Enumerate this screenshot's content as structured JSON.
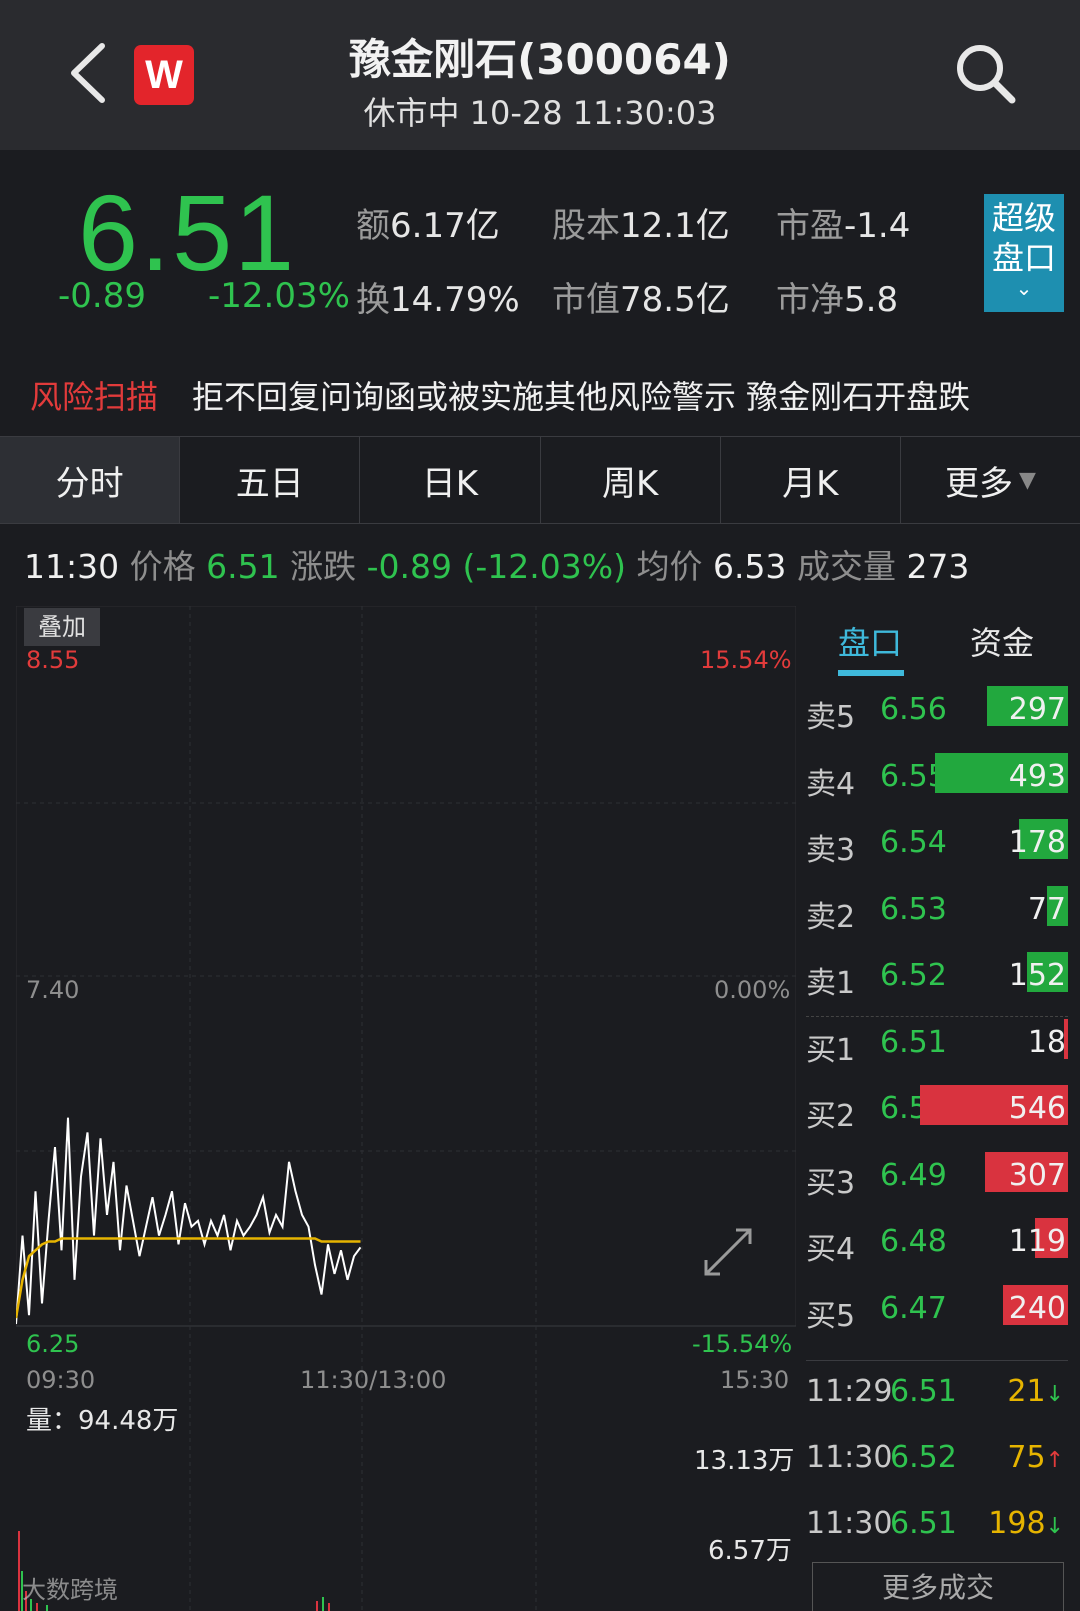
{
  "header": {
    "title": "豫金刚石(300064)",
    "subtitle": "休市中 10-28 11:30:03",
    "logo_letter": "W"
  },
  "quote": {
    "price": "6.51",
    "change": "-0.89",
    "change_pct": "-12.03%",
    "stats": [
      {
        "label": "额",
        "value": "6.17亿"
      },
      {
        "label": "股本",
        "value": "12.1亿"
      },
      {
        "label": "市盈",
        "value": "-1.4"
      },
      {
        "label": "换",
        "value": "14.79%"
      },
      {
        "label": "市值",
        "value": "78.5亿"
      },
      {
        "label": "市净",
        "value": "5.8"
      }
    ],
    "super_label_1": "超级",
    "super_label_2": "盘口"
  },
  "risk": {
    "tag": "风险扫描",
    "text": "拒不回复问询函或被实施其他风险警示 豫金刚石开盘跌"
  },
  "tabs": [
    "分时",
    "五日",
    "日K",
    "周K",
    "月K",
    "更多"
  ],
  "info_line": {
    "time": "11:30",
    "price_label": "价格",
    "price": "6.51",
    "chg_label": "涨跌",
    "chg": "-0.89 (-12.03%)",
    "avg_label": "均价",
    "avg": "6.53",
    "vol_label": "成交量",
    "vol": "273"
  },
  "chart_labels": {
    "overlay_button": "叠加",
    "y_high": "8.55",
    "y_mid": "7.40",
    "y_low": "6.25",
    "pct_high": "15.54%",
    "pct_mid": "0.00%",
    "pct_low": "-15.54%",
    "x_start": "09:30",
    "x_mid": "11:30/13:00",
    "x_end": "15:30",
    "volume_label": "量：94.48万",
    "vol_high": "13.13万",
    "vol_mid": "6.57万"
  },
  "chart_data": {
    "type": "line",
    "ylim": [
      6.25,
      8.55
    ],
    "series": [
      {
        "values": [
          6.25,
          6.55,
          6.28,
          6.7,
          6.32,
          6.6,
          6.85,
          6.5,
          6.95,
          6.4,
          6.75,
          6.9,
          6.55,
          6.88,
          6.62,
          6.8,
          6.5,
          6.72,
          6.6,
          6.48,
          6.58,
          6.68,
          6.55,
          6.62,
          6.7,
          6.52,
          6.66,
          6.58,
          6.6,
          6.52,
          6.6,
          6.55,
          6.62,
          6.5,
          6.6,
          6.55,
          6.58,
          6.62,
          6.68,
          6.56,
          6.62,
          6.58,
          6.8,
          6.7,
          6.62,
          6.58,
          6.45,
          6.35,
          6.52,
          6.42,
          6.5,
          6.4,
          6.48,
          6.51
        ]
      },
      {
        "values": [
          6.27,
          6.4,
          6.48,
          6.5,
          6.52,
          6.53,
          6.53,
          6.54,
          6.54,
          6.54,
          6.54,
          6.54,
          6.54,
          6.54,
          6.54,
          6.54,
          6.54,
          6.54,
          6.54,
          6.54,
          6.54,
          6.54,
          6.54,
          6.54,
          6.54,
          6.54,
          6.54,
          6.54,
          6.54,
          6.54,
          6.54,
          6.54,
          6.54,
          6.54,
          6.54,
          6.54,
          6.54,
          6.54,
          6.54,
          6.54,
          6.54,
          6.54,
          6.54,
          6.54,
          6.54,
          6.54,
          6.54,
          6.53,
          6.53,
          6.53,
          6.53,
          6.53,
          6.53,
          6.53
        ]
      }
    ],
    "x_total_points": 121,
    "xlabels": [
      "09:30",
      "11:30/13:00",
      "15:30"
    ]
  },
  "book_tabs": [
    "盘口",
    "资金"
  ],
  "order_book": [
    {
      "side": "卖5",
      "price": "6.56",
      "vol": "297",
      "bar": 0.55,
      "color": "#22a83e"
    },
    {
      "side": "卖4",
      "price": "6.55",
      "vol": "493",
      "bar": 0.9,
      "color": "#22a83e"
    },
    {
      "side": "卖3",
      "price": "6.54",
      "vol": "178",
      "bar": 0.33,
      "color": "#22a83e"
    },
    {
      "side": "卖2",
      "price": "6.53",
      "vol": "77",
      "bar": 0.14,
      "color": "#22a83e"
    },
    {
      "side": "卖1",
      "price": "6.52",
      "vol": "152",
      "bar": 0.28,
      "color": "#22a83e"
    },
    {
      "side": "买1",
      "price": "6.51",
      "vol": "18",
      "bar": 0.03,
      "color": "#d9333f"
    },
    {
      "side": "买2",
      "price": "6.50",
      "vol": "546",
      "bar": 1.0,
      "color": "#d9333f"
    },
    {
      "side": "买3",
      "price": "6.49",
      "vol": "307",
      "bar": 0.56,
      "color": "#d9333f"
    },
    {
      "side": "买4",
      "price": "6.48",
      "vol": "119",
      "bar": 0.22,
      "color": "#d9333f"
    },
    {
      "side": "买5",
      "price": "6.47",
      "vol": "240",
      "bar": 0.44,
      "color": "#d9333f"
    }
  ],
  "trades": [
    {
      "time": "11:29",
      "price": "6.51",
      "vol": "21",
      "arrow": "↓",
      "arrow_color": "#2fc34f"
    },
    {
      "time": "11:30",
      "price": "6.52",
      "vol": "75",
      "arrow": "↑",
      "arrow_color": "#e23b3b"
    },
    {
      "time": "11:30",
      "price": "6.51",
      "vol": "198",
      "arrow": "↓",
      "arrow_color": "#2fc34f"
    }
  ],
  "more_trades_label": "更多成交",
  "watermark": "大数跨境",
  "colors": {
    "down": "#2fc34f",
    "up": "#e23b3b",
    "accent": "#3fb9db"
  }
}
